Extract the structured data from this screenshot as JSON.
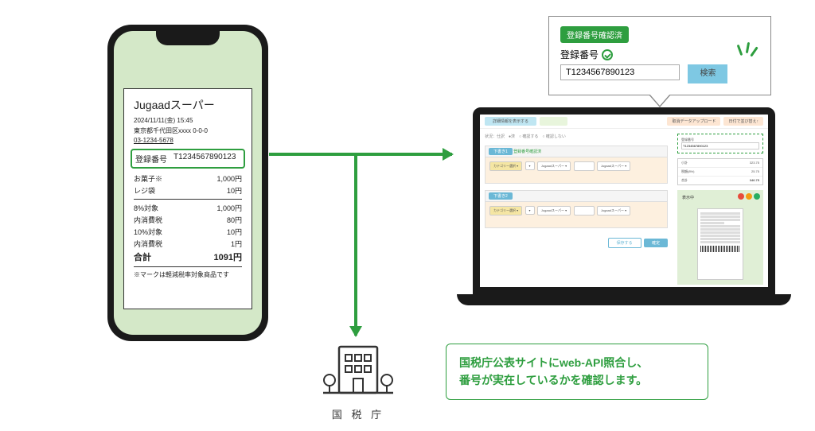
{
  "receipt": {
    "store": "Jugaadスーパー",
    "datetime": "2024/11/11(金)  15:45",
    "address": "東京都千代田区xxxx 0-0-0",
    "phone": "03-1234-5678",
    "reg_label": "登録番号",
    "reg_no": "T1234567890123",
    "items": [
      {
        "name": "お菓子※",
        "price": "1,000円"
      },
      {
        "name": "レジ袋",
        "price": "10円"
      }
    ],
    "tax": [
      {
        "name": "8%対象",
        "price": "1,000円"
      },
      {
        "name": "内消費税",
        "price": "80円"
      },
      {
        "name": "10%対象",
        "price": "10円"
      },
      {
        "name": "内消費税",
        "price": "1円"
      }
    ],
    "total_label": "合計",
    "total": "1091円",
    "note": "※マークは軽減税率対象商品です"
  },
  "callout": {
    "badge": "登録番号確認済",
    "label": "登録番号",
    "value": "T1234567890123",
    "search": "検索"
  },
  "app": {
    "top_btn1": "詳細情報を表示する",
    "top_btn2": "",
    "top_r1": "取消データアップロード",
    "top_r2": "日付で並び替え↑",
    "status": "状況：仕訳　●済　○ 確認する　○ 確認しない",
    "tab": "下書き1",
    "verify": "登録番号確認済",
    "reg_label": "登録番号",
    "reg_value": "T1234567890123",
    "sum": [
      {
        "k": "小計",
        "v": "323.75"
      },
      {
        "k": "税額(8%)",
        "v": "25.75"
      },
      {
        "k": "合計",
        "v": "346.75"
      }
    ],
    "view": "表示中",
    "action1": "保存する",
    "action2": "確定"
  },
  "bldg": {
    "label": "国 税 庁"
  },
  "explain": {
    "l1": "国税庁公表サイトにweb-API照合し、",
    "l2": "番号が実在しているかを確認します。"
  }
}
